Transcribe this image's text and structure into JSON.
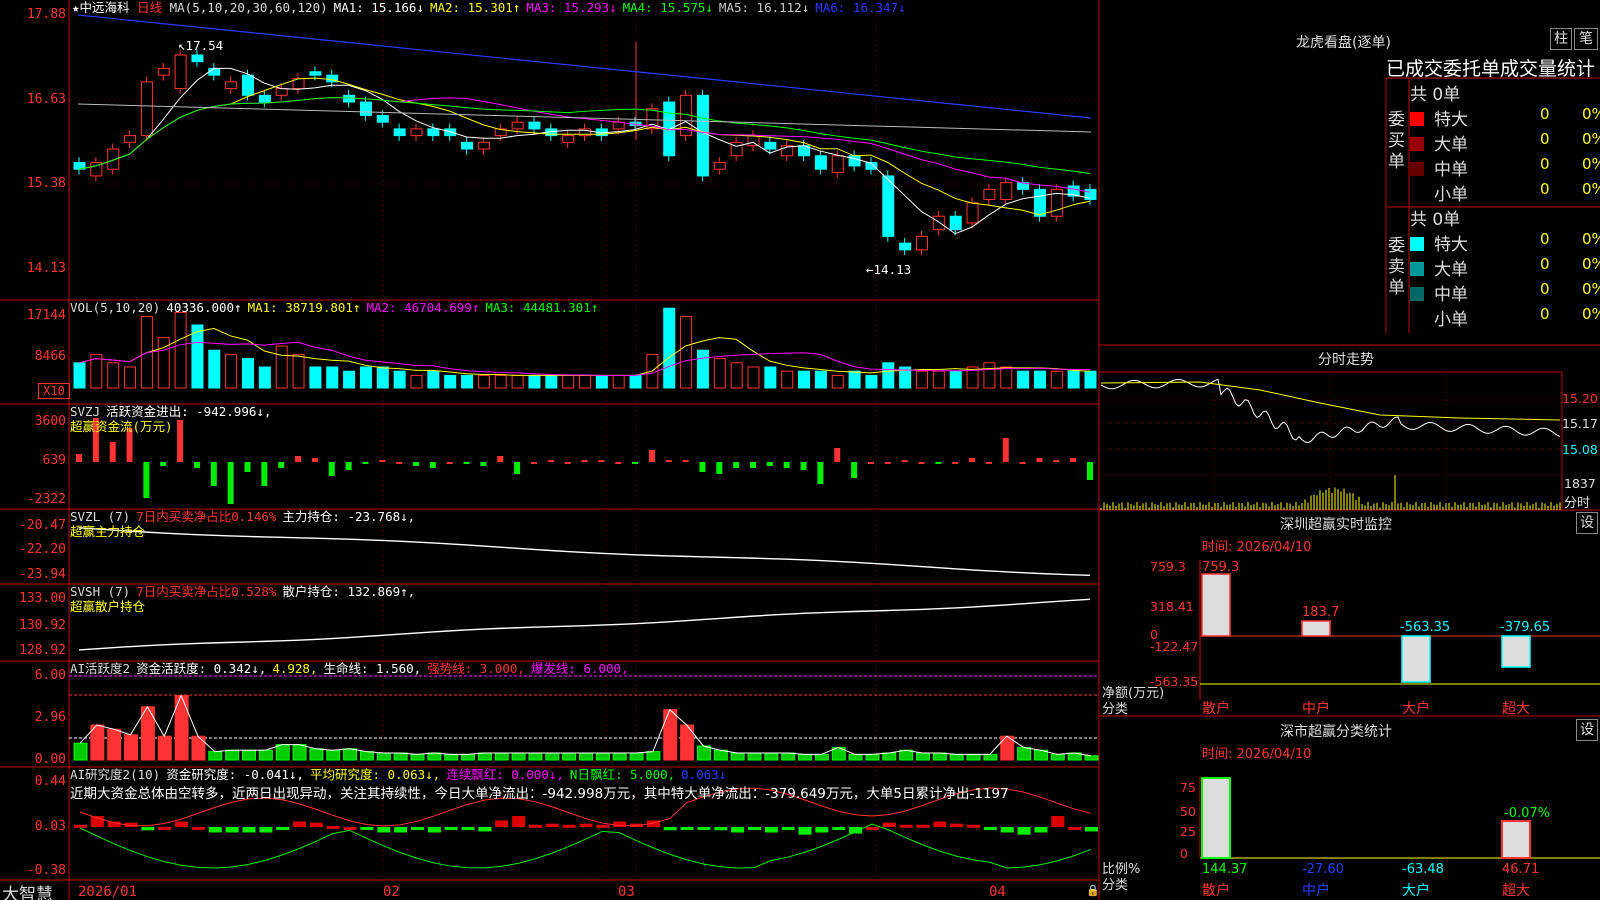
{
  "stock": {
    "star": "★",
    "name": "中远海科",
    "period": "日线"
  },
  "headers": {
    "price": [
      {
        "t": "MA(5,10,20,30,60,120)",
        "c": "#dddddd"
      },
      {
        "t": "MA1: 15.166↓",
        "c": "#ffffff"
      },
      {
        "t": "MA2: 15.301↑",
        "c": "#ffff00"
      },
      {
        "t": "MA3: 15.293↓",
        "c": "#ff00ff"
      },
      {
        "t": "MA4: 15.575↓",
        "c": "#00ff00"
      },
      {
        "t": "MA5: 16.112↓",
        "c": "#cccccc"
      },
      {
        "t": "MA6: 16.347↓",
        "c": "#2a3cff"
      }
    ],
    "vol": [
      {
        "t": "VOL(5,10,20)",
        "c": "#dddddd"
      },
      {
        "t": "40336.000↑",
        "c": "#ffffff"
      },
      {
        "t": "MA1: 38719.801↑",
        "c": "#ffff00"
      },
      {
        "t": "MA2: 46704.699↑",
        "c": "#ff00ff"
      },
      {
        "t": "MA3: 44481.301↑",
        "c": "#00ff00"
      }
    ],
    "svzj": [
      {
        "t": "SVZJ",
        "c": "#dddddd"
      },
      {
        "t": "活跃资金进出: -942.996↓,",
        "c": "#ffffff"
      }
    ],
    "svzj2": "超赢资金流(万元)",
    "svzl": [
      {
        "t": "SVZL (7)",
        "c": "#dddddd"
      },
      {
        "t": "7日内买卖净占比0.146%",
        "c": "#ff3333"
      },
      {
        "t": "主力持仓: -23.768↓,",
        "c": "#ffffff"
      }
    ],
    "svzl2": "超赢主力持仓",
    "svsh": [
      {
        "t": "SVSH (7)",
        "c": "#dddddd"
      },
      {
        "t": "7日内买卖净占比0.528%",
        "c": "#ff3333"
      },
      {
        "t": "散户持仓: 132.869↑,",
        "c": "#ffffff"
      }
    ],
    "svsh2": "超赢散户持仓",
    "ai1": [
      {
        "t": "AI活跃度2",
        "c": "#dddddd"
      },
      {
        "t": "资金活跃度: 0.342↓,",
        "c": "#ffffff"
      },
      {
        "t": "4.928,",
        "c": "#ffff00"
      },
      {
        "t": "生命线: 1.560,",
        "c": "#ffffff"
      },
      {
        "t": "强势线: 3.000,",
        "c": "#ff3333"
      },
      {
        "t": "爆发线: 6.000,",
        "c": "#ff00ff"
      }
    ],
    "ai2": [
      {
        "t": "AI研究度2(10)",
        "c": "#dddddd"
      },
      {
        "t": "资金研究度: -0.041↓,",
        "c": "#ffffff"
      },
      {
        "t": "平均研究度: 0.063↓,",
        "c": "#ffff00"
      },
      {
        "t": "连续飘红: 0.000↓,",
        "c": "#ff00ff"
      },
      {
        "t": "N日飘红: 5.000,",
        "c": "#00ff00"
      },
      {
        "t": "0.063↓",
        "c": "#2a3cff"
      }
    ],
    "ai2_note": "近期大资金总体由空转多，近两日出现异动，关注其持续性，今日大单净流出：-942.998万元，其中特大单净流出：-379.649万元，大单5日累计净出-1197"
  },
  "price_ticks": [
    "17.88",
    "16.63",
    "15.38",
    "14.13"
  ],
  "vol_ticks": [
    "17144",
    "8466"
  ],
  "vol_unit": "X10",
  "svzj_ticks": [
    "3600",
    "639",
    "-2322"
  ],
  "svzl_ticks": [
    "-20.47",
    "-22.20",
    "-23.94"
  ],
  "svsh_ticks": [
    "133.00",
    "130.92",
    "128.92"
  ],
  "ai1_ticks": [
    "6.00",
    "2.96",
    "0.00"
  ],
  "ai2_ticks": [
    "0.44",
    "0.03",
    "-0.38"
  ],
  "annot_high": "17.54",
  "annot_low": "14.13",
  "dates": [
    "2026/01",
    "02",
    "03",
    "04"
  ],
  "brand": "大智慧",
  "right": {
    "lhb_title": "龙虎看盘(逐单)",
    "btn_zhu": "柱",
    "btn_bi": "笔",
    "stats_title": "已成交委托单成交量统计",
    "buy_label": "委买单",
    "sell_label": "委卖单",
    "buy_total": "共 0单",
    "sell_total": "共 0单",
    "buy_rows": [
      {
        "name": "特大",
        "color": "#ff0000",
        "num": "0",
        "pct": "0%"
      },
      {
        "name": "大单",
        "color": "#990000",
        "num": "0",
        "pct": "0%"
      },
      {
        "name": "中单",
        "color": "#660000",
        "num": "0",
        "pct": "0%"
      },
      {
        "name": "小单",
        "color": "",
        "num": "0",
        "pct": "0%"
      }
    ],
    "sell_rows": [
      {
        "name": "特大",
        "color": "#00ffff",
        "num": "0",
        "pct": "0%"
      },
      {
        "name": "大单",
        "color": "#009999",
        "num": "0",
        "pct": "0%"
      },
      {
        "name": "中单",
        "color": "#006666",
        "num": "0",
        "pct": "0%"
      },
      {
        "name": "小单",
        "color": "",
        "num": "0",
        "pct": "0%"
      }
    ],
    "fs_title": "分时走势",
    "fs_ticks": [
      "15.20",
      "15.17",
      "15.08"
    ],
    "fs_vol": "1837",
    "fs_unit": "分时",
    "sz_title": "深圳超赢实时监控",
    "sz_btn": "设",
    "sz_time": "时间: 2026/04/10",
    "sz_ticks": [
      "759.3",
      "318.41",
      "0",
      "-122.47",
      "-563.35"
    ],
    "sz_values": [
      "759.3",
      "183.7",
      "-563.35",
      "-379.65"
    ],
    "sz_ylabel": "净额(万元)",
    "sz_xlabel": "分类",
    "cats": [
      "散户",
      "中户",
      "大户",
      "超大"
    ],
    "cl_title": "深市超赢分类统计",
    "cl_btn": "设",
    "cl_time": "时间: 2026/04/10",
    "cl_ticks": [
      "75",
      "50",
      "25",
      "0"
    ],
    "cl_top": "-0.07%",
    "cl_values": [
      "144.37",
      "-27.60",
      "-63.48",
      "46.71"
    ],
    "cl_ylabel": "比例%",
    "cl_xlabel": "分类"
  },
  "colors": {
    "up": "#ff3333",
    "down": "#00ffff",
    "grid": "#c00000"
  }
}
